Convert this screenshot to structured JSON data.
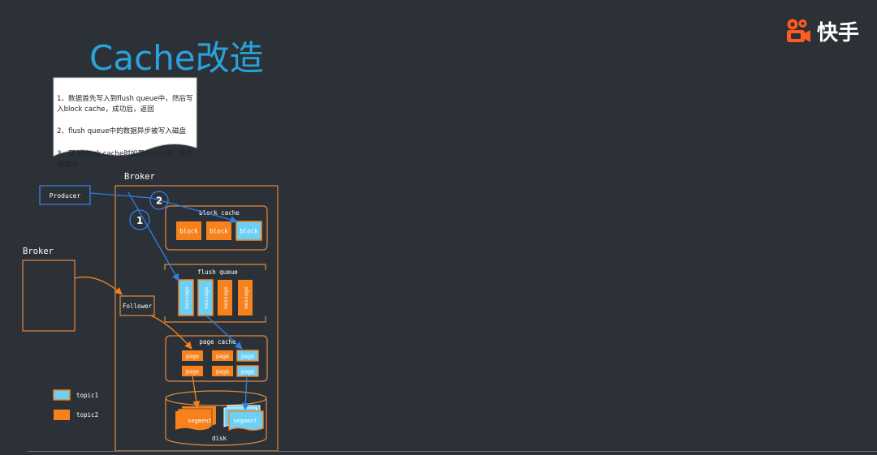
{
  "title": "Cache改造",
  "logo": {
    "text": "快手",
    "icon": "kuaishou-camera-icon",
    "color": "#ff5a1f"
  },
  "note": {
    "lines": [
      "1、数据首先写入到flush queue中，然后写入block cache，成功后，返回",
      "2、flush queue中的数据异步被写入磁盘",
      "3、写入block cache时如果cache满，则主动淘汰"
    ]
  },
  "diagram": {
    "producer": "Producer",
    "broker_main": "Broker",
    "broker_left": "Broker",
    "follower": "Follower",
    "step_1": "1",
    "step_2": "2",
    "block_cache": {
      "label": "block cache",
      "items": [
        {
          "text": "block",
          "topic": "topic2"
        },
        {
          "text": "block",
          "topic": "topic2"
        },
        {
          "text": "block",
          "topic": "topic1"
        }
      ]
    },
    "flush_queue": {
      "label": "flush queue",
      "items": [
        {
          "text": "message",
          "topic": "topic1"
        },
        {
          "text": "message",
          "topic": "topic1"
        },
        {
          "text": "message",
          "topic": "topic2"
        },
        {
          "text": "message",
          "topic": "topic2"
        }
      ]
    },
    "page_cache": {
      "label": "page cache",
      "items": [
        {
          "text": "page",
          "topic": "topic2"
        },
        {
          "text": "page",
          "topic": "topic2"
        },
        {
          "text": "page",
          "topic": "topic1"
        },
        {
          "text": "page",
          "topic": "topic2"
        },
        {
          "text": "page",
          "topic": "topic2"
        },
        {
          "text": "page",
          "topic": "topic1"
        }
      ]
    },
    "disk": {
      "label": "disk",
      "segments": [
        {
          "text": "segment",
          "topic": "topic2"
        },
        {
          "text": "segment",
          "topic": "topic1"
        }
      ]
    },
    "legend": [
      {
        "label": "topic1",
        "color": "#6ccff6"
      },
      {
        "label": "topic2",
        "color": "#f7821b"
      }
    ]
  },
  "colors": {
    "background": "#2c3137",
    "title": "#2aa3dc",
    "orange": "#f7821b",
    "blue_box": "#6ccff6",
    "arrow_blue": "#2f7fe0",
    "arrow_orange": "#f7821b",
    "producer_border": "#3a7fd8",
    "container_border": "#e48a3c"
  }
}
